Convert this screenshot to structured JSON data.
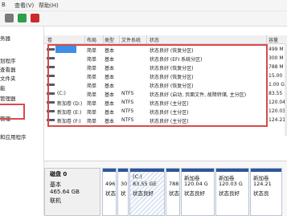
{
  "menubar": {
    "items": [
      "B",
      "查看(V)",
      "帮助(H)"
    ]
  },
  "left_nav": {
    "items": [
      "",
      "",
      "",
      "",
      "",
      "",
      "",
      "",
      ""
    ]
  },
  "left_nav_frag": {
    "line1": "务器",
    "line2": "划程序",
    "line3": "查看器",
    "line4": "文件夹",
    "line5": "能",
    "line6": "管理器",
    "line7": "",
    "line8": "管理",
    "line9": "和应用程序"
  },
  "table": {
    "headers": [
      "卷",
      "布局",
      "类型",
      "文件系统",
      "状态",
      "容量"
    ],
    "rows": [
      {
        "vol": "",
        "layout": "简单",
        "type": "基本",
        "fs": "",
        "status": "状态良好 (恢复分区)",
        "cap": "499 M"
      },
      {
        "vol": "",
        "layout": "简单",
        "type": "基本",
        "fs": "",
        "status": "状态良好 (EFI 系统分区)",
        "cap": "300 M"
      },
      {
        "vol": "",
        "layout": "简单",
        "type": "基本",
        "fs": "",
        "status": "状态良好 (恢复分区)",
        "cap": "788 M"
      },
      {
        "vol": "",
        "layout": "简单",
        "type": "基本",
        "fs": "",
        "status": "状态良好 (恢复分区)",
        "cap": "15.00"
      },
      {
        "vol": "",
        "layout": "简单",
        "type": "基本",
        "fs": "",
        "status": "状态良好 (恢复分区)",
        "cap": "1.00 G"
      },
      {
        "vol": "(C:)",
        "layout": "简单",
        "type": "基本",
        "fs": "NTFS",
        "status": "状态良好 (启动, 页面文件, 故障转储, 主分区)",
        "cap": "83.55"
      },
      {
        "vol": "新加卷 (D:)",
        "layout": "简单",
        "type": "基本",
        "fs": "NTFS",
        "status": "状态良好 (主分区)",
        "cap": "120.04"
      },
      {
        "vol": "新加卷 (E:)",
        "layout": "简单",
        "type": "基本",
        "fs": "NTFS",
        "status": "状态良好 (主分区)",
        "cap": "120.03"
      },
      {
        "vol": "新加卷 (F:)",
        "layout": "简单",
        "type": "基本",
        "fs": "NTFS",
        "status": "状态良好 (主分区)",
        "cap": "124.21"
      }
    ]
  },
  "disk": {
    "title": "磁盘 0",
    "type": "基本",
    "size": "465.64 GB",
    "status": "联机"
  },
  "partitions": [
    {
      "line1": "",
      "line2": "496",
      "line3": "状态"
    },
    {
      "line1": "",
      "line2": "30",
      "line3": "状"
    },
    {
      "line1": "(C:)",
      "line2": "83.55 GE",
      "line3": "状态良好"
    },
    {
      "line1": "",
      "line2": "788",
      "line3": "状态"
    },
    {
      "line1": "新加卷",
      "line2": "120.04 G",
      "line3": "状态良好"
    },
    {
      "line1": "新加卷",
      "line2": "120.03 G",
      "line3": "状态良好"
    },
    {
      "line1": "新加卷",
      "line2": "124.21",
      "line3": "状态良"
    }
  ],
  "colors": {
    "highlight": "#3f8ee8",
    "redbox": "#d94a4a",
    "partition_bar": "#2f5597"
  }
}
